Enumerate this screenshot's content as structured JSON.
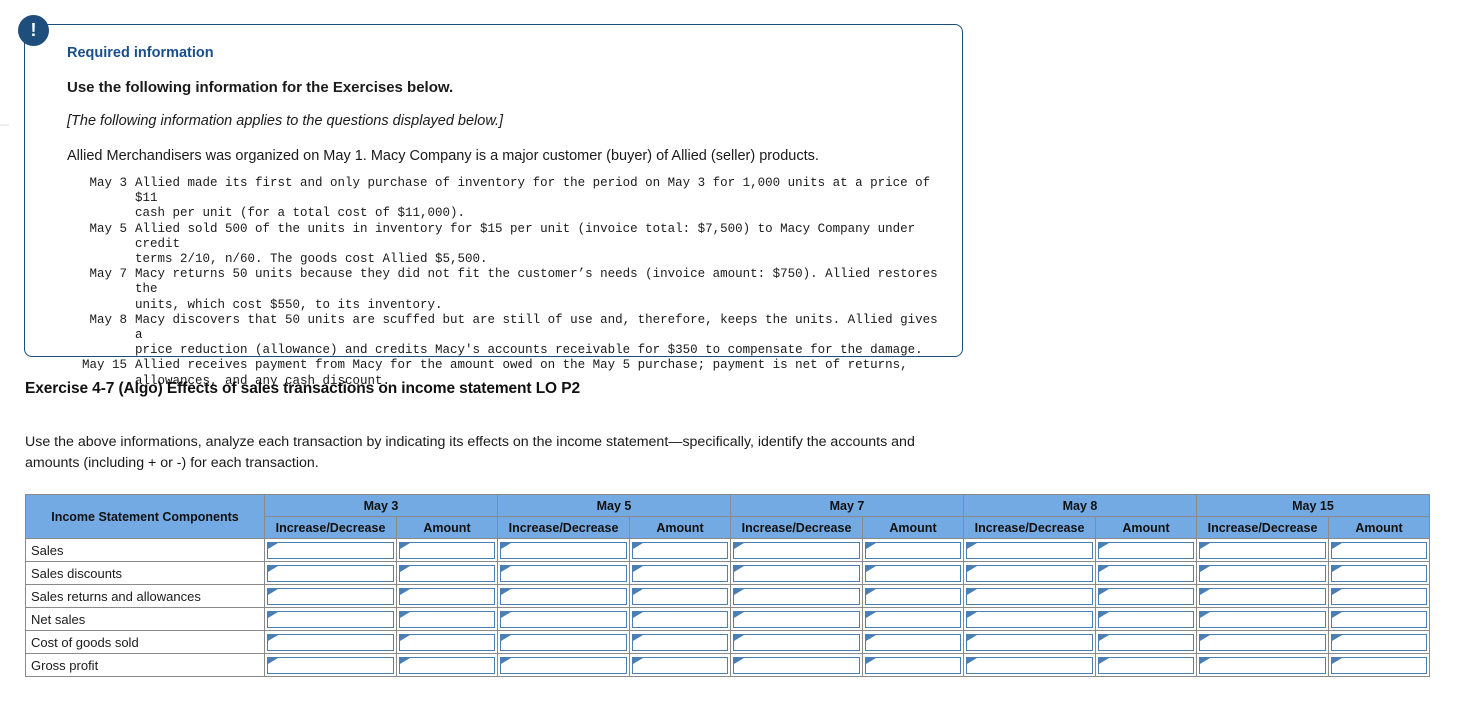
{
  "info_panel": {
    "badge_icon": "exclamation-icon",
    "required_label": "Required information",
    "use_heading": "Use the following information for the Exercises below.",
    "applies_note": "[The following information applies to the questions displayed below.]",
    "intro_paragraph": "Allied Merchandisers was organized on May 1. Macy Company is a major customer (buyer) of Allied (seller) products.",
    "transactions": [
      {
        "date": "May 3",
        "text": "Allied made its first and only purchase of inventory for the period on May 3 for 1,000 units at a price of $11\ncash per unit (for a total cost of $11,000)."
      },
      {
        "date": "May 5",
        "text": "Allied sold 500 of the units in inventory for $15 per unit (invoice total: $7,500) to Macy Company under credit\nterms 2/10, n/60. The goods cost Allied $5,500."
      },
      {
        "date": "May 7",
        "text": "Macy returns 50 units because they did not fit the customer’s needs (invoice amount: $750). Allied restores the\nunits, which cost $550, to its inventory."
      },
      {
        "date": "May 8",
        "text": "Macy discovers that 50 units are scuffed but are still of use and, therefore, keeps the units. Allied gives a\nprice reduction (allowance) and credits Macy's accounts receivable for $350 to compensate for the damage."
      },
      {
        "date": "May 15",
        "text": "Allied receives payment from Macy for the amount owed on the May 5 purchase; payment is net of returns,\nallowances, and any cash discount."
      }
    ]
  },
  "exercise": {
    "title": "Exercise 4-7 (Algo) Effects of sales transactions on income statement LO P2",
    "instructions": "Use the above informations, analyze each transaction by indicating its effects on the income statement—specifically, identify the accounts and amounts (including + or -) for each transaction."
  },
  "table": {
    "component_header": "Income Statement Components",
    "date_columns": [
      "May 3",
      "May 5",
      "May 7",
      "May 8",
      "May 15"
    ],
    "sub_headers": [
      "Increase/Decrease",
      "Amount"
    ],
    "rows": [
      {
        "label": "Sales",
        "cells": [
          "",
          "",
          "",
          "",
          "",
          "",
          "",
          "",
          "",
          ""
        ]
      },
      {
        "label": "Sales discounts",
        "cells": [
          "",
          "",
          "",
          "",
          "",
          "",
          "",
          "",
          "",
          ""
        ]
      },
      {
        "label": "Sales returns and allowances",
        "cells": [
          "",
          "",
          "",
          "",
          "",
          "",
          "",
          "",
          "",
          ""
        ]
      },
      {
        "label": "Net sales",
        "cells": [
          "",
          "",
          "",
          "",
          "",
          "",
          "",
          "",
          "",
          ""
        ]
      },
      {
        "label": "Cost of goods sold",
        "cells": [
          "",
          "",
          "",
          "",
          "",
          "",
          "",
          "",
          "",
          ""
        ]
      },
      {
        "label": "Gross profit",
        "cells": [
          "",
          "",
          "",
          "",
          "",
          "",
          "",
          "",
          "",
          ""
        ]
      }
    ]
  },
  "colors": {
    "panel_border": "#1a4e79",
    "badge": "#1d4e7c",
    "heading_blue": "#1a4e8a",
    "table_header_blue": "#74aae3",
    "input_border_blue": "#4a7fb5"
  }
}
